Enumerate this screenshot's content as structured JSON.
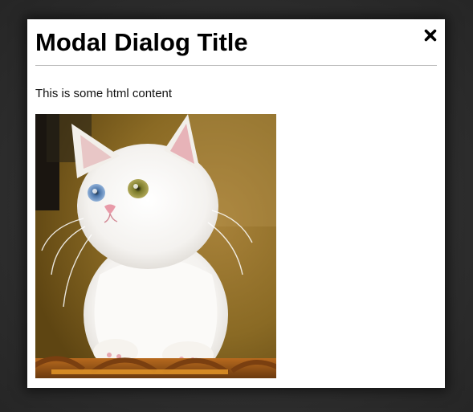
{
  "modal": {
    "title": "Modal Dialog Title",
    "close_icon": "close-icon",
    "body_text": "This is some html content",
    "image": {
      "subject": "white kitten photo",
      "icon": "kitten-image"
    }
  },
  "colors": {
    "backdrop": "#2f2f2f",
    "modal_bg": "#ffffff",
    "divider": "#bdbdbd",
    "text": "#000000"
  }
}
